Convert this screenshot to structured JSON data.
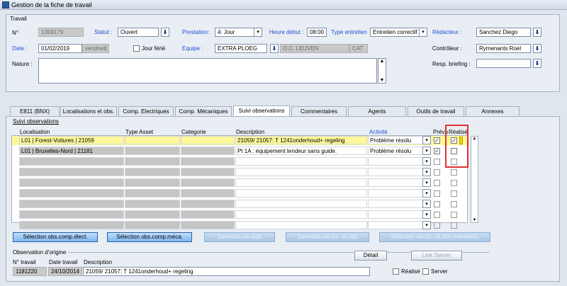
{
  "window": {
    "title": "Gestion de la fiche de travail"
  },
  "travail": {
    "group_label": "Travail",
    "numero_label": "N°",
    "numero_value": "1359179",
    "statut_label": "Statut :",
    "statut_value": "Ouvert",
    "prestation_label": "Prestation:",
    "prestation_value": "4: Jour",
    "heure_label": "Heure début :",
    "heure_value": "08:00",
    "type_label": "Type entretien",
    "type_value": "Entretien correctif",
    "redacteur_label": "Rédacteur :",
    "redacteur_value": "Sanchez Diego",
    "date_label": "Date :",
    "date_value": "01/02/2019",
    "jour_value": "vendredi",
    "ferie_label": "Jour férié",
    "equipe_label": "Equipe :",
    "equipe_value": "EXTRA PLOEG",
    "oc_value": "O.C. LEUVEN",
    "cat_value": "CAT",
    "controleur_label": "Contrôleur :",
    "controleur_value": "Rymenants Roel",
    "nature_label": "Nature :",
    "briefing_label": "Resp. briefing :"
  },
  "tabs": [
    {
      "label": "E811 (BNX)"
    },
    {
      "label": "Localisations et obs."
    },
    {
      "label": "Comp. Electriques"
    },
    {
      "label": "Comp. Mécaniques"
    },
    {
      "label": "Suivi observations"
    },
    {
      "label": "Commentaires"
    },
    {
      "label": "Agents"
    },
    {
      "label": "Outils de travail"
    },
    {
      "label": "Annexes"
    }
  ],
  "suivi": {
    "group_label": "Suivi observations",
    "columns": {
      "localisation": "Localisation",
      "type_asset": "Type Asset",
      "categorie": "Categorie",
      "description": "Description",
      "activite": "Activité",
      "prevu": "Prévu",
      "realise": "Réalisé"
    },
    "rows": [
      {
        "localisation": "L01 | Forest-Voitures | 21059",
        "type_asset": "",
        "categorie": "",
        "description": "21059/ 21057: T 1241onderhoud+ regeling",
        "activite": "Problème résolu",
        "prevu": true,
        "realise": true
      },
      {
        "localisation": "L01 | Bruxelles-Nord | 21181",
        "type_asset": "",
        "categorie": "",
        "description": "Pt 1A : équipement tendeur sans guide.",
        "activite": "Problème résolu",
        "prevu": true,
        "realise": false
      }
    ]
  },
  "buttons": {
    "sel_elec": "Sélection obs.comp.élect.",
    "sel_meca": "Sélection obs.comp.méca.",
    "sel_tabll": "Sélection via tabll",
    "sel_loc": "Sélection via loc. et obs",
    "sel_loc_restr": "Sélection via loc. et obs restreintes"
  },
  "origine": {
    "group_label": "Observation d'origine",
    "numero_label": "N° travail",
    "date_label": "Date travail",
    "desc_label": "Description",
    "numero_value": "1181220",
    "date_value": "24/10/2014",
    "desc_value": "21059/ 21057: T 1241onderhoud+ regeling",
    "detail_button": "Détail",
    "link_button": "Link Server",
    "realise_label": "Réalisé",
    "server_label": "Server"
  },
  "check_mark": "✓"
}
